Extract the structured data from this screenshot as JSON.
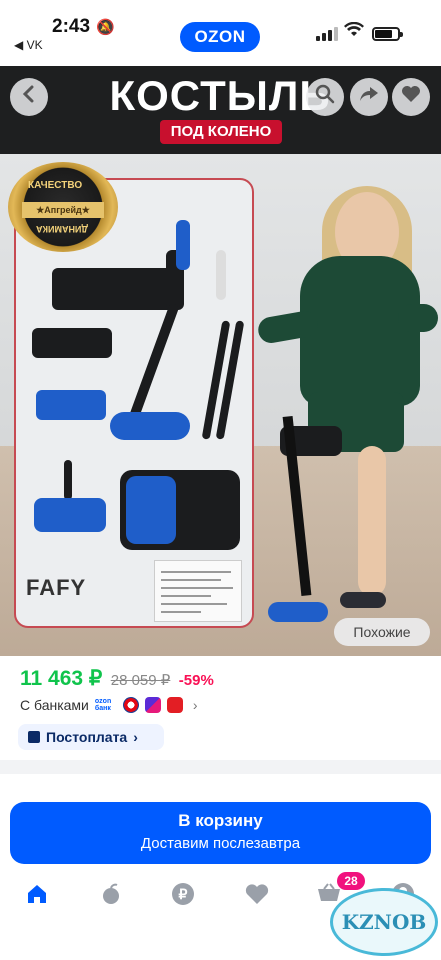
{
  "status_bar": {
    "time": "2:43",
    "back_app": "VK",
    "center_pill": "OZON"
  },
  "product_image": {
    "banner_title": "КОСТЫЛЬ",
    "banner_subtitle": "ПОД КОЛЕНО",
    "badge_top": "КАЧЕСТВО",
    "badge_ribbon": "★Апгрейд★",
    "badge_bottom": "ДИНАМИКА",
    "brand_logo": "FAFY",
    "similar_label": "Похожие",
    "icons": [
      "back-icon",
      "search-icon",
      "share-icon",
      "heart-icon"
    ]
  },
  "pricing": {
    "price": "11 463 ₽",
    "old_price": "28 059 ₽",
    "discount": "-59%",
    "banks_label": "С банками",
    "ozon_bank_logo_text": "ozon банк"
  },
  "postpay": {
    "label": "Постоплата"
  },
  "cart_button": {
    "title": "В корзину",
    "subtitle": "Доставим послезавтра"
  },
  "tabbar": {
    "cart_badge": "28",
    "tabs": [
      "home",
      "catalog",
      "ruble",
      "favorites",
      "cart",
      "profile"
    ]
  },
  "watermark": "KZNOB",
  "colors": {
    "brand_blue": "#005bff",
    "price_green": "#10c44c",
    "discount_red": "#f91155",
    "badge_pink": "#f1117e"
  }
}
